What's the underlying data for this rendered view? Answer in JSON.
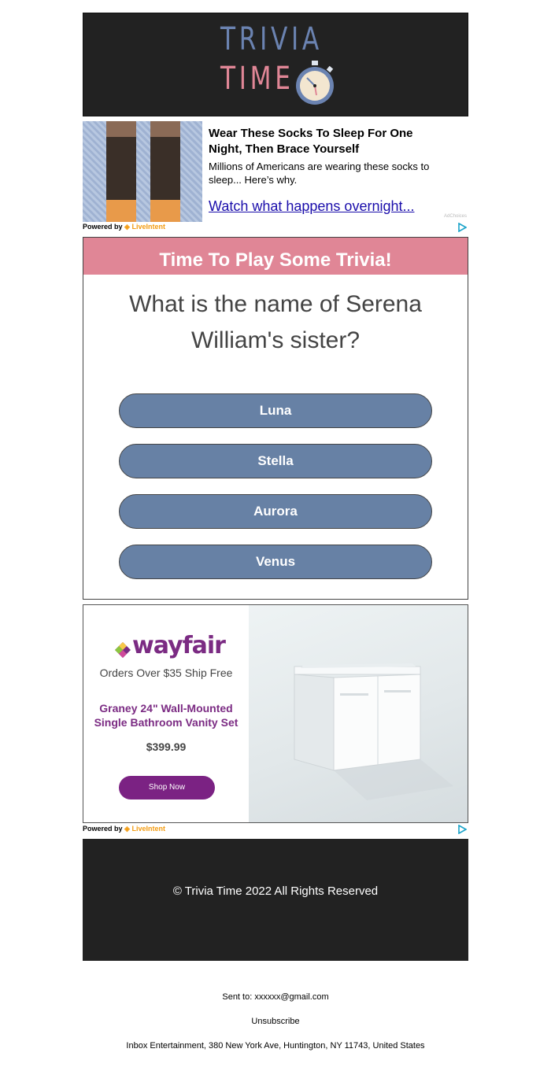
{
  "header": {
    "logo_line1": "TRIVIA",
    "logo_line2": "TIME",
    "logo_colors": {
      "blue": "#6b83b1",
      "pink": "#e08696",
      "background": "#222222"
    }
  },
  "ad_top": {
    "title": "Wear These Socks To Sleep For One Night, Then Brace Yourself",
    "body": "Millions of Americans are wearing these socks to sleep... Here’s why.",
    "link": "Watch what happens overnight...",
    "ad_choices": "AdChoices",
    "powered_by": "Powered by",
    "brand": "LiveIntent"
  },
  "trivia": {
    "heading": "Time To Play Some Trivia!",
    "question": "What is the name of Serena William's sister?",
    "answers": [
      "Luna",
      "Stella",
      "Aurora",
      "Venus"
    ],
    "colors": {
      "header": "#e08696",
      "button": "#6781a5"
    }
  },
  "ad_wayfair": {
    "brand": "wayfair",
    "shipping": "Orders Over $35 Ship Free",
    "product": "Graney 24\" Wall-Mounted Single Bathroom Vanity Set",
    "price": "$399.99",
    "cta": "Shop Now",
    "powered_by": "Powered by",
    "provider": "LiveIntent",
    "accent": "#7b2283"
  },
  "footer": {
    "copyright": "© Trivia Time 2022 All Rights Reserved"
  },
  "meta": {
    "sent_to": "Sent to: xxxxxx@gmail.com",
    "unsubscribe": "Unsubscribe",
    "address": "Inbox Entertainment, 380 New York Ave, Huntington, NY 11743, United States"
  }
}
